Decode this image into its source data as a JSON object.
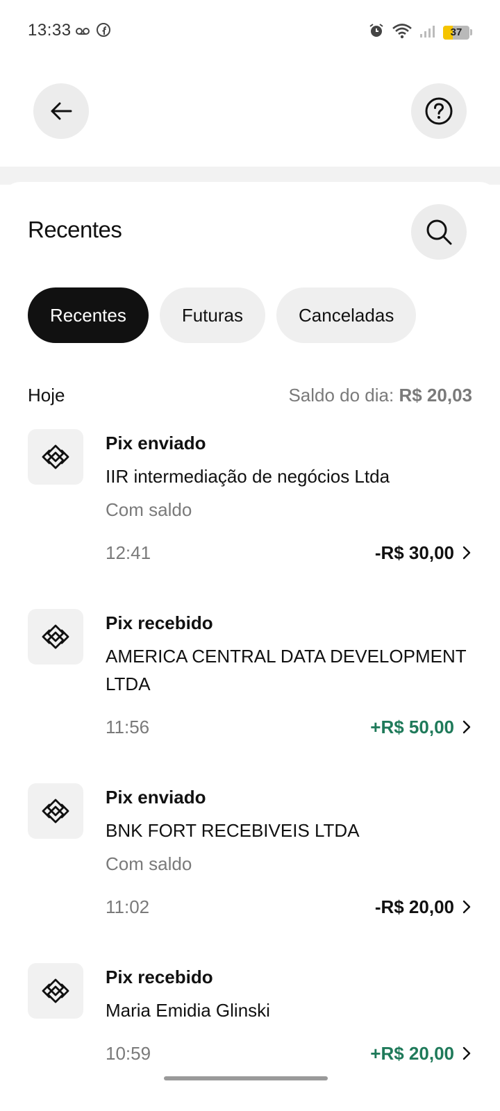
{
  "status_bar": {
    "time": "13:33",
    "battery": "37",
    "battery_level": 0.37
  },
  "header": {
    "back_label": "Voltar",
    "help_label": "Ajuda"
  },
  "section": {
    "title": "Recentes"
  },
  "filters": [
    {
      "label": "Recentes",
      "active": true
    },
    {
      "label": "Futuras",
      "active": false
    },
    {
      "label": "Canceladas",
      "active": false
    }
  ],
  "day": {
    "label": "Hoje",
    "balance_label": "Saldo do dia:",
    "balance_value": "R$ 20,03"
  },
  "transactions": [
    {
      "type": "Pix enviado",
      "name": "IIR intermediação de negócios Ltda",
      "method": "Com saldo",
      "time": "12:41",
      "amount": "-R$ 30,00",
      "direction": "out"
    },
    {
      "type": "Pix recebido",
      "name": "AMERICA CENTRAL DATA DEVELOPMENT LTDA",
      "method": "",
      "time": "11:56",
      "amount": "+R$ 50,00",
      "direction": "in"
    },
    {
      "type": "Pix enviado",
      "name": "BNK FORT RECEBIVEIS LTDA",
      "method": "Com saldo",
      "time": "11:02",
      "amount": "-R$ 20,00",
      "direction": "out"
    },
    {
      "type": "Pix recebido",
      "name": "Maria Emidia Glinski",
      "method": "",
      "time": "10:59",
      "amount": "+R$ 20,00",
      "direction": "in"
    }
  ],
  "colors": {
    "positive": "#1f7a5a",
    "active_chip": "#111111",
    "chip": "#efefef",
    "muted": "#7a7a7a"
  }
}
